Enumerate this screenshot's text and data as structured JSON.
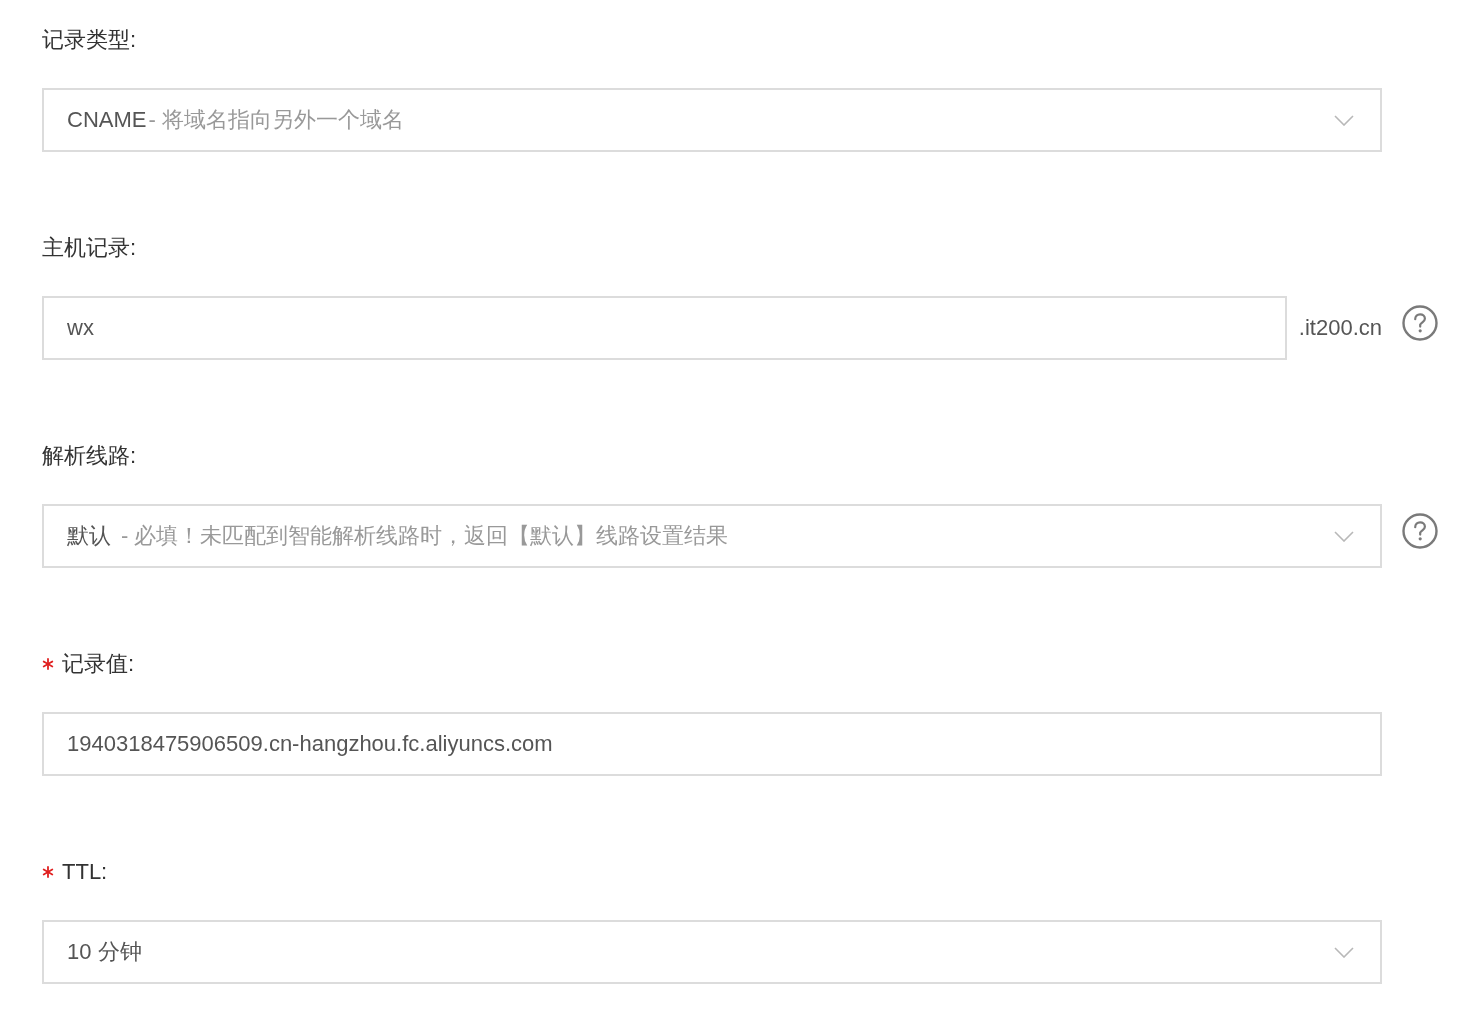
{
  "fields": [
    {
      "kind": "select",
      "label": "记录类型:",
      "required": false,
      "value": "CNAME",
      "hint": "- 将域名指向另外一个域名",
      "help": false
    },
    {
      "kind": "input",
      "label": "主机记录:",
      "required": false,
      "value": "wx",
      "suffix": ".it200.cn",
      "help": true
    },
    {
      "kind": "select",
      "label": "解析线路:",
      "required": false,
      "value": "默认",
      "hint": "- 必填！未匹配到智能解析线路时，返回【默认】线路设置结果",
      "help": true
    },
    {
      "kind": "input",
      "label": "记录值:",
      "required": true,
      "value": "1940318475906509.cn-hangzhou.fc.aliyuncs.com",
      "help": false
    },
    {
      "kind": "select",
      "label": "TTL:",
      "required": true,
      "value": "10 分钟",
      "help": false
    }
  ]
}
